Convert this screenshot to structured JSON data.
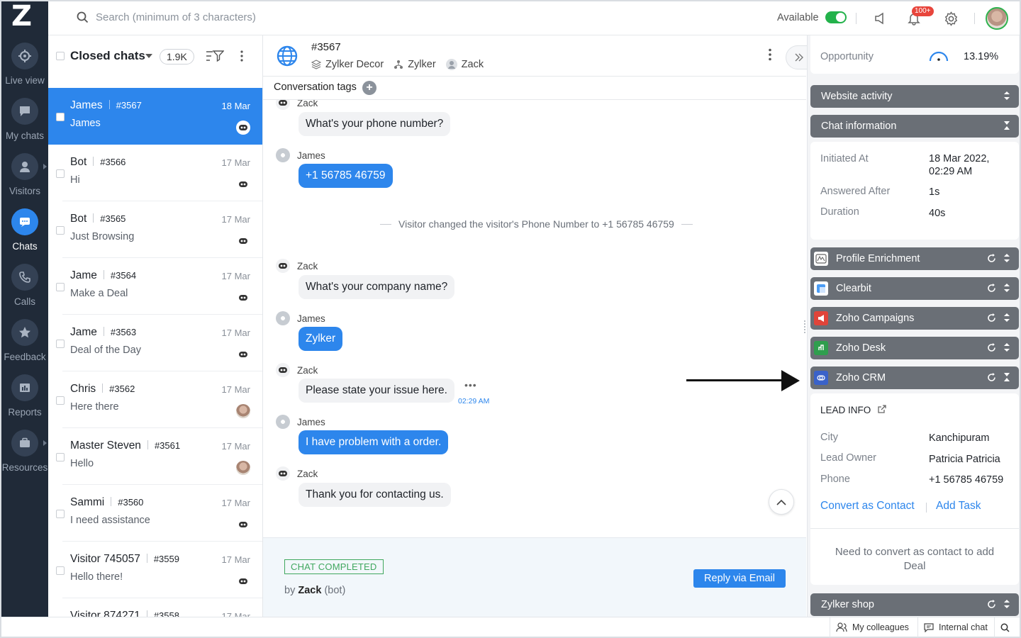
{
  "colors": {
    "accent": "#2d86ec",
    "nav_bg": "#202a38",
    "section_header": "#6a6f76",
    "status_green": "#23b24b"
  },
  "nav": {
    "logo": "Z",
    "items": [
      {
        "label": "Live view",
        "icon": "crosshair-icon"
      },
      {
        "label": "My chats",
        "icon": "chat-bubble-icon"
      },
      {
        "label": "Visitors",
        "icon": "person-icon"
      },
      {
        "label": "Chats",
        "icon": "chat-icon"
      },
      {
        "label": "Calls",
        "icon": "phone-icon"
      },
      {
        "label": "Feedback",
        "icon": "star-icon"
      },
      {
        "label": "Reports",
        "icon": "bar-chart-icon"
      },
      {
        "label": "Resources",
        "icon": "briefcase-icon"
      }
    ]
  },
  "topbar": {
    "search_placeholder": "Search (minimum of 3 characters)",
    "availability": "Available",
    "notification_count": "100+"
  },
  "chat_list": {
    "title": "Closed chats",
    "count": "1.9K",
    "rows": [
      {
        "name": "James",
        "id": "#3567",
        "date": "18 Mar",
        "message": "James",
        "avatar": "bot"
      },
      {
        "name": "Bot",
        "id": "#3566",
        "date": "17 Mar",
        "message": "Hi",
        "avatar": "bot"
      },
      {
        "name": "Bot",
        "id": "#3565",
        "date": "17 Mar",
        "message": "Just Browsing",
        "avatar": "bot"
      },
      {
        "name": "Jame",
        "id": "#3564",
        "date": "17 Mar",
        "message": "Make a Deal",
        "avatar": "bot"
      },
      {
        "name": "Jame",
        "id": "#3563",
        "date": "17 Mar",
        "message": "Deal of the Day",
        "avatar": "bot"
      },
      {
        "name": "Chris",
        "id": "#3562",
        "date": "17 Mar",
        "message": "Here there",
        "avatar": "photo"
      },
      {
        "name": "Master Steven",
        "id": "#3561",
        "date": "17 Mar",
        "message": "Hello",
        "avatar": "photo"
      },
      {
        "name": "Sammi",
        "id": "#3560",
        "date": "17 Mar",
        "message": "I need assistance",
        "avatar": "bot"
      },
      {
        "name": "Visitor 745057",
        "id": "#3559",
        "date": "17 Mar",
        "message": "Hello there!",
        "avatar": "bot"
      },
      {
        "name": "Visitor 874271",
        "id": "#3558",
        "date": "17 Mar",
        "message": "",
        "avatar": "bot"
      }
    ]
  },
  "conversation": {
    "id": "#3567",
    "portal": "Zylker Decor",
    "department": "Zylker",
    "agent": "Zack",
    "tags_label": "Conversation tags",
    "messages": [
      {
        "sender": "Zack",
        "text": "What's your phone number?"
      },
      {
        "sender": "James",
        "text": "+1 56785 46759"
      },
      {
        "sender": "Zack",
        "text": "What's your company name?"
      },
      {
        "sender": "James",
        "text": "Zylker"
      },
      {
        "sender": "Zack",
        "text": "Please state your issue here."
      },
      {
        "sender": "James",
        "text": "I have problem with a order."
      },
      {
        "sender": "Zack",
        "text": "Thank you for contacting us."
      }
    ],
    "system_message": "Visitor changed the visitor's Phone Number to +1 56785 46759",
    "message_time": "02:29 AM",
    "status": "CHAT COMPLETED",
    "completed_by_prefix": "by",
    "completed_by": "Zack",
    "completed_by_suffix": "(bot)",
    "reply_button": "Reply via Email"
  },
  "right_panel": {
    "opportunity_label": "Opportunity",
    "opportunity_value": "13.19%",
    "website_activity": "Website activity",
    "chat_info": {
      "title": "Chat information",
      "initiated_label": "Initiated At",
      "initiated_value_line1": "18 Mar 2022,",
      "initiated_value_line2": "02:29 AM",
      "answered_label": "Answered After",
      "answered_value": "1s",
      "duration_label": "Duration",
      "duration_value": "40s"
    },
    "integrations": [
      {
        "name": "Profile Enrichment",
        "icon": "profile-enrichment-icon"
      },
      {
        "name": "Clearbit",
        "icon": "clearbit-icon"
      },
      {
        "name": "Zoho Campaigns",
        "icon": "zoho-campaigns-icon"
      },
      {
        "name": "Zoho Desk",
        "icon": "zoho-desk-icon"
      },
      {
        "name": "Zoho CRM",
        "icon": "zoho-crm-icon"
      }
    ],
    "crm": {
      "section_title": "LEAD INFO",
      "city_label": "City",
      "city_value": "Kanchipuram",
      "owner_label": "Lead Owner",
      "owner_value": "Patricia Patricia",
      "phone_label": "Phone",
      "phone_value": "+1 56785 46759",
      "convert_link": "Convert as Contact",
      "task_link": "Add Task",
      "deal_note": "Need to convert as contact to add Deal"
    },
    "shop": "Zylker shop"
  },
  "bottombar": {
    "colleagues": "My colleagues",
    "internal_chat": "Internal chat"
  }
}
